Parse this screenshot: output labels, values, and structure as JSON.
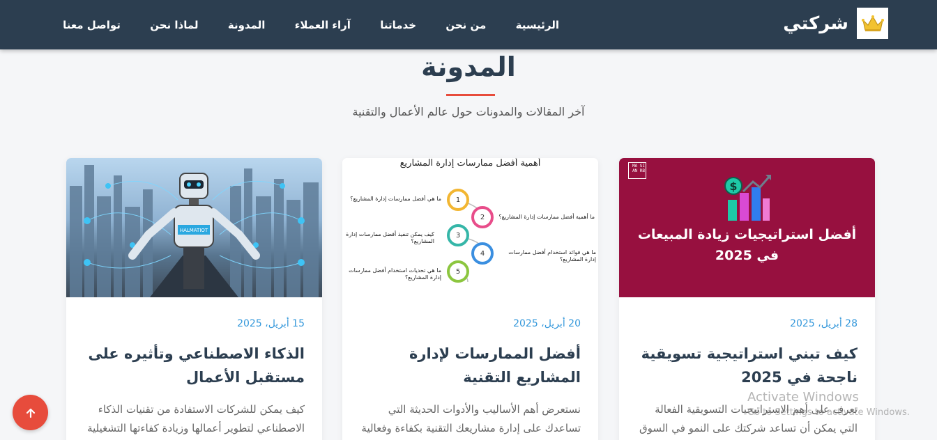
{
  "brand": {
    "name": "شركتي",
    "logo_icon": "crown-icon"
  },
  "nav": {
    "items": [
      "الرئيسية",
      "من نحن",
      "خدماتنا",
      "آراء العملاء",
      "المدونة",
      "لماذا نحن",
      "تواصل معنا"
    ]
  },
  "section": {
    "title": "المدونة",
    "subtitle": "آخر المقالات والمدونات حول عالم الأعمال والتقنية"
  },
  "posts": [
    {
      "date": "28 أبريل، 2025",
      "title": "كيف تبني استراتيجية تسويقية ناجحة في 2025",
      "excerpt": "تعرف على أهم الاستراتيجيات التسويقية الفعالة التي يمكن أن تساعد شركتك على النمو في السوق الحالي",
      "image": {
        "logo_text": "MA SI AN RB",
        "headline_line1": "أفضل استراتيجيات زيادة المبيعات",
        "headline_line2": "في 2025",
        "icon": "sales-chart-icon"
      }
    },
    {
      "date": "20 أبريل، 2025",
      "title": "أفضل الممارسات لإدارة المشاريع التقنية",
      "excerpt": "نستعرض أهم الأساليب والأدوات الحديثة التي تساعدك على إدارة مشاريعك التقنية بكفاءة وفعالية",
      "image": {
        "title": "أهمية أفضل ممارسات إدارة المشاريع",
        "steps": [
          {
            "n": "1",
            "label": "ما هي أفضل ممارسات إدارة المشاريع؟"
          },
          {
            "n": "2",
            "label": "ما أهمية أفضل ممارسات إدارة المشاريع؟"
          },
          {
            "n": "3",
            "label": "كيف يمكن تنفيذ أفضل ممارسات إدارة المشاريع؟"
          },
          {
            "n": "4",
            "label": "ما هي فوائد استخدام أفضل ممارسات إدارة المشاريع؟"
          },
          {
            "n": "5",
            "label": "ما هي تحديات استخدام أفضل ممارسات إدارة المشاريع؟"
          }
        ]
      }
    },
    {
      "date": "15 أبريل، 2025",
      "title": "الذكاء الاصطناعي وتأثيره على مستقبل الأعمال",
      "excerpt": "كيف يمكن للشركات الاستفادة من تقنيات الذكاء الاصطناعي لتطوير أعمالها وزيادة كفاءتها التشغيلية",
      "image": {
        "badge": "HALMATIOT",
        "icon": "robot-city-icon"
      }
    }
  ],
  "back_to_top": {
    "icon": "arrow-up-icon"
  },
  "watermark": {
    "line1": "Activate Windows",
    "line2": "Go to Settings to activate Windows."
  },
  "colors": {
    "navbar": "#2c3e50",
    "accent": "#e74c3c",
    "date": "#3498db",
    "sales_bg": "#97103f"
  }
}
